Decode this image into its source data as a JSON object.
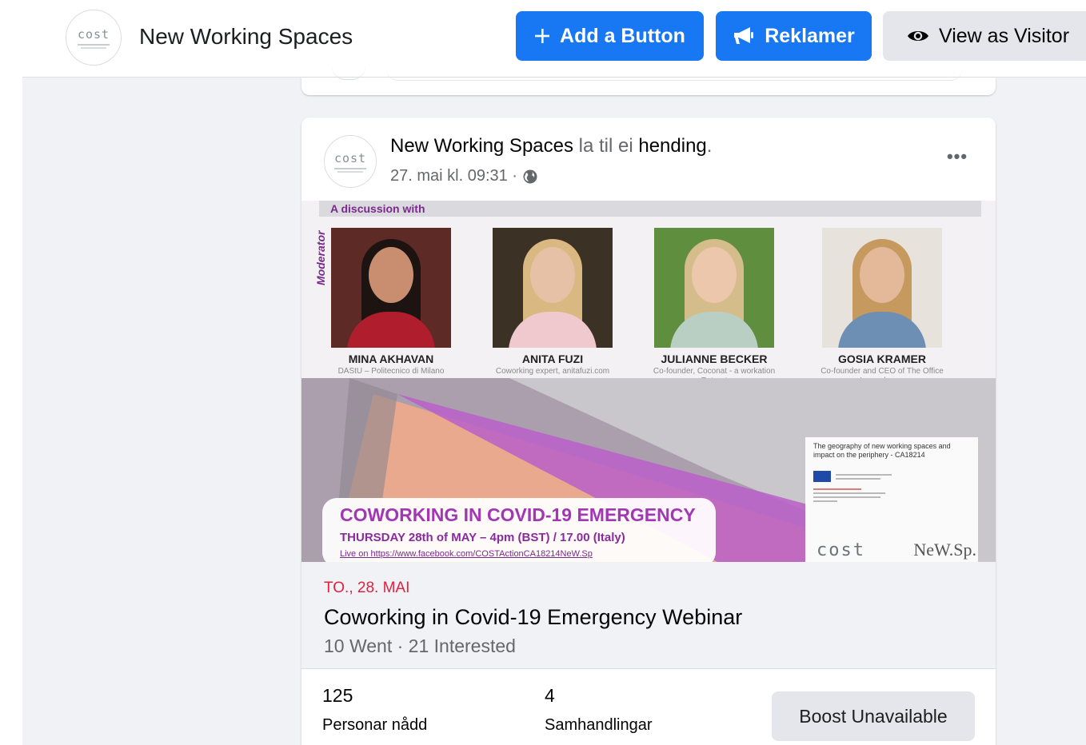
{
  "header": {
    "page_name": "New Working Spaces",
    "avatar_logo_text": "cost",
    "add_button_label": "Add a Button",
    "ads_button_label": "Reklamer",
    "view_as_visitor_label": "View as Visitor"
  },
  "post": {
    "author": "New Working Spaces",
    "action_text": "la til ei",
    "action_object": "hending",
    "timestamp": "27. mai kl. 09:31 ·",
    "more_label": "•••",
    "avatar_logo_text": "cost"
  },
  "banner": {
    "heading": "A discussion with",
    "moderator_label": "Moderator",
    "speakers": [
      {
        "name": "MINA AKHAVAN",
        "role": "DAStU – Politecnico di Milano"
      },
      {
        "name": "ANITA FUZI",
        "role": "Coworking expert, anitafuzi.com"
      },
      {
        "name": "JULIANNE BECKER",
        "role": "Co-founder, Coconat - a workation Retreat"
      },
      {
        "name": "GOSIA KRAMER",
        "role": "Co-founder and CEO of The Office Luxembourg"
      }
    ],
    "event_title": "COWORKING IN COVID-19 EMERGENCY",
    "event_datetime": "THURSDAY 28th of MAY – 4pm (BST) / 17.00 (Italy)",
    "event_link": "Live on https://www.facebook.com/COSTActionCA18214NeW.Sp",
    "project_title": "The geography of new working spaces and impact on the periphery - CA18214",
    "logo_cost": "cost",
    "logo_newsp": "NeW.Sp."
  },
  "event": {
    "date_label": "TO., 28. MAI",
    "title": "Coworking in Covid-19 Emergency Webinar",
    "stats": "10 Went · 21 Interested"
  },
  "insights": {
    "reach_value": "125",
    "reach_label": "Personar nådd",
    "engagement_value": "4",
    "engagement_label": "Samhandlingar",
    "boost_label": "Boost Unavailable"
  },
  "colors": {
    "accent_blue": "#1877f2",
    "event_date_red": "#e41e3f",
    "banner_purple": "#a236b5",
    "secondary_text": "#65676b"
  },
  "icons": {
    "add": "plus-icon",
    "ads": "megaphone-icon",
    "visitor": "eye-icon",
    "privacy": "globe-icon",
    "more": "more-options-icon"
  }
}
